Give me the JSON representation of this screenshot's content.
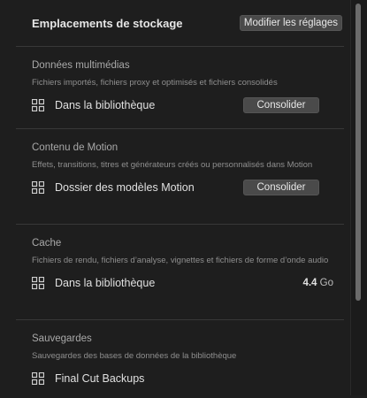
{
  "header": {
    "title": "Emplacements de stockage",
    "modify_button": "Modifier les réglages"
  },
  "sections": [
    {
      "title": "Données multimédias",
      "description": "Fichiers importés, fichiers proxy et optimisés et fichiers consolidés",
      "location": "Dans la bibliothèque",
      "action": "Consolider"
    },
    {
      "title": "Contenu de Motion",
      "description": "Effets, transitions, titres et générateurs créés ou personnalisés dans Motion",
      "location": "Dossier des modèles Motion",
      "action": "Consolider"
    },
    {
      "title": "Cache",
      "description": "Fichiers de rendu, fichiers d’analyse, vignettes et fichiers de forme d’onde audio",
      "location": "Dans la bibliothèque",
      "size_value": "4.4",
      "size_unit": "Go"
    },
    {
      "title": "Sauvegardes",
      "description": "Sauvegardes des bases de données de la bibliothèque",
      "location": "Final Cut Backups"
    }
  ]
}
